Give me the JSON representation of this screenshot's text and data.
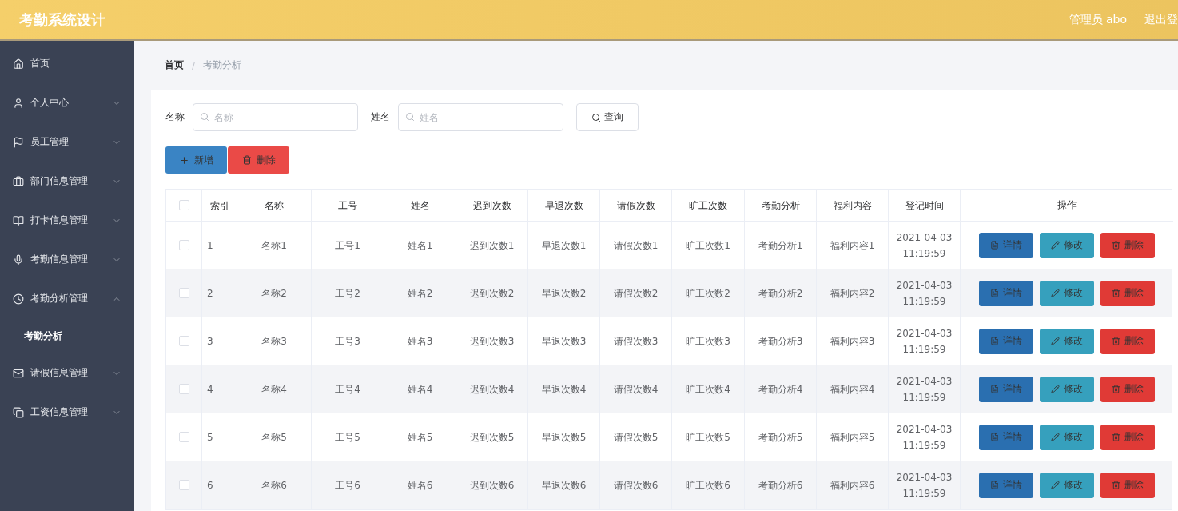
{
  "header": {
    "title": "考勤系统设计",
    "user": "管理员 abo",
    "logout": "退出登"
  },
  "sidebar": {
    "items": [
      {
        "label": "首页",
        "expandable": false
      },
      {
        "label": "个人中心",
        "expandable": true,
        "expanded": false
      },
      {
        "label": "员工管理",
        "expandable": true,
        "expanded": false
      },
      {
        "label": "部门信息管理",
        "expandable": true,
        "expanded": false
      },
      {
        "label": "打卡信息管理",
        "expandable": true,
        "expanded": false
      },
      {
        "label": "考勤信息管理",
        "expandable": true,
        "expanded": false
      },
      {
        "label": "考勤分析管理",
        "expandable": true,
        "expanded": true,
        "children": [
          {
            "label": "考勤分析",
            "selected": true
          }
        ]
      },
      {
        "label": "请假信息管理",
        "expandable": true,
        "expanded": false
      },
      {
        "label": "工资信息管理",
        "expandable": true,
        "expanded": false
      }
    ]
  },
  "breadcrumb": {
    "separator": "/",
    "items": [
      "首页",
      "考勤分析"
    ]
  },
  "search": {
    "fields": [
      {
        "label": "名称",
        "placeholder": "名称"
      },
      {
        "label": "姓名",
        "placeholder": "姓名"
      }
    ],
    "button": "查询"
  },
  "actions": {
    "add": "新增",
    "delete": "删除"
  },
  "table": {
    "header_checked": false,
    "columns": [
      "索引",
      "名称",
      "工号",
      "姓名",
      "迟到次数",
      "早退次数",
      "请假次数",
      "旷工次数",
      "考勤分析",
      "福利内容",
      "登记时间",
      "操作"
    ],
    "rows": [
      {
        "checked": false,
        "cells": [
          "1",
          "名称1",
          "工号1",
          "姓名1",
          "迟到次数1",
          "早退次数1",
          "请假次数1",
          "旷工次数1",
          "考勤分析1",
          "福利内容1",
          "2021-04-03 11:19:59"
        ],
        "buttons": [
          "详情",
          "修改",
          "删除"
        ]
      },
      {
        "checked": false,
        "cells": [
          "2",
          "名称2",
          "工号2",
          "姓名2",
          "迟到次数2",
          "早退次数2",
          "请假次数2",
          "旷工次数2",
          "考勤分析2",
          "福利内容2",
          "2021-04-03 11:19:59"
        ],
        "buttons": [
          "详情",
          "修改",
          "删除"
        ]
      },
      {
        "checked": false,
        "cells": [
          "3",
          "名称3",
          "工号3",
          "姓名3",
          "迟到次数3",
          "早退次数3",
          "请假次数3",
          "旷工次数3",
          "考勤分析3",
          "福利内容3",
          "2021-04-03 11:19:59"
        ],
        "buttons": [
          "详情",
          "修改",
          "删除"
        ]
      },
      {
        "checked": false,
        "cells": [
          "4",
          "名称4",
          "工号4",
          "姓名4",
          "迟到次数4",
          "早退次数4",
          "请假次数4",
          "旷工次数4",
          "考勤分析4",
          "福利内容4",
          "2021-04-03 11:19:59"
        ],
        "buttons": [
          "详情",
          "修改",
          "删除"
        ]
      },
      {
        "checked": false,
        "cells": [
          "5",
          "名称5",
          "工号5",
          "姓名5",
          "迟到次数5",
          "早退次数5",
          "请假次数5",
          "旷工次数5",
          "考勤分析5",
          "福利内容5",
          "2021-04-03 11:19:59"
        ],
        "buttons": [
          "详情",
          "修改",
          "删除"
        ]
      },
      {
        "checked": false,
        "cells": [
          "6",
          "名称6",
          "工号6",
          "姓名6",
          "迟到次数6",
          "早退次数6",
          "请假次数6",
          "旷工次数6",
          "考勤分析6",
          "福利内容6",
          "2021-04-03 11:19:59"
        ],
        "buttons": [
          "详情",
          "修改",
          "删除"
        ]
      }
    ]
  }
}
